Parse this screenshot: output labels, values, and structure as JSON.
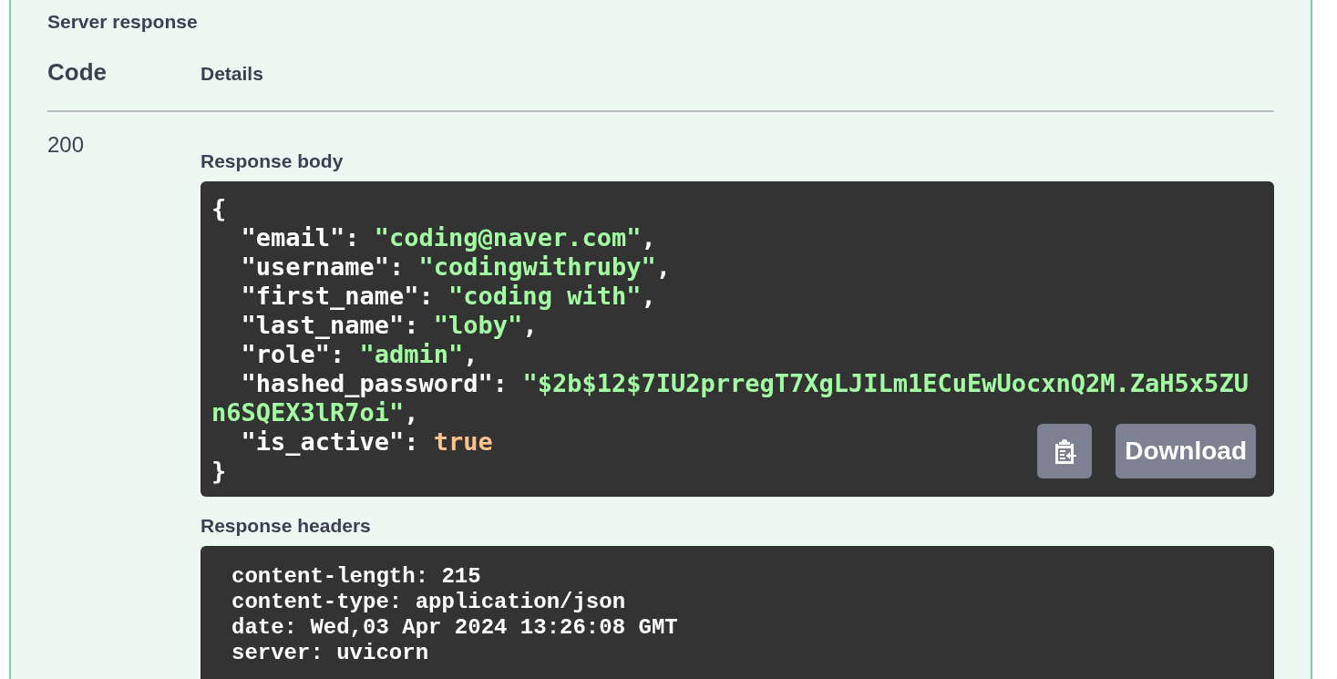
{
  "section_title": "Server response",
  "columns": [
    "Code",
    "Details"
  ],
  "response": {
    "code": "200",
    "body_title": "Response body",
    "body_lines": [
      {
        "kind": "punct",
        "text": "{"
      },
      {
        "kind": "pair",
        "key": "\"email\":",
        "value": "\"coding@naver.com\"",
        "color": "#a2fca2",
        "suffix": ","
      },
      {
        "kind": "pair",
        "key": "\"username\":",
        "value": "\"codingwithruby\"",
        "color": "#a2fca2",
        "suffix": ","
      },
      {
        "kind": "pair",
        "key": "\"first_name\":",
        "value": "\"coding with\"",
        "color": "#a2fca2",
        "suffix": ","
      },
      {
        "kind": "pair",
        "key": "\"last_name\":",
        "value": "\"loby\"",
        "color": "#a2fca2",
        "suffix": ","
      },
      {
        "kind": "pair",
        "key": "\"role\":",
        "value": "\"admin\"",
        "color": "#a2fca2",
        "suffix": ","
      },
      {
        "kind": "pair",
        "key": "\"hashed_password\":",
        "value": "\"$2b$12$7IU2prregT7XgLJILm1ECuEwUocxnQ2M.ZaH5x5ZUn6SQEX3lR7oi\"",
        "color": "#a2fca2",
        "suffix": ","
      },
      {
        "kind": "pair",
        "key": "\"is_active\":",
        "value": "true",
        "color": "#fcc28c"
      },
      {
        "kind": "punct",
        "text": "}"
      }
    ],
    "download_label": "Download",
    "headers_title": "Response headers",
    "headers": [
      "content-length: 215",
      "content-type: application/json",
      "date: Wed,03 Apr 2024 13:26:08 GMT",
      "server: uvicorn"
    ]
  }
}
